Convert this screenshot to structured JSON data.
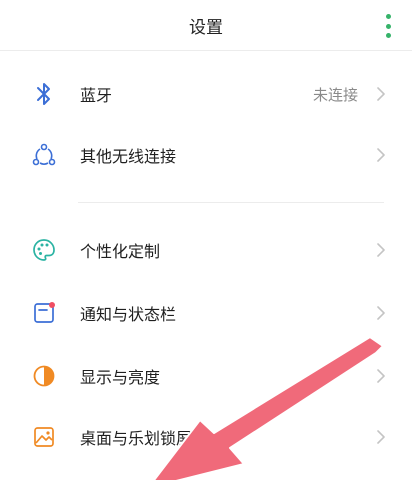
{
  "header": {
    "title": "设置",
    "more_icon": "more-vertical-icon"
  },
  "colors": {
    "accent": "#35b36a",
    "arrow": "#f06a7a"
  },
  "settings": {
    "items": [
      {
        "label": "蓝牙",
        "status": "未连接",
        "icon": "bluetooth-icon"
      },
      {
        "label": "其他无线连接",
        "status": "",
        "icon": "wireless-share-icon"
      },
      {
        "label": "个性化定制",
        "status": "",
        "icon": "palette-icon"
      },
      {
        "label": "通知与状态栏",
        "status": "",
        "icon": "notification-icon"
      },
      {
        "label": "显示与亮度",
        "status": "",
        "icon": "brightness-icon"
      },
      {
        "label": "桌面与乐划锁屏",
        "status": "",
        "icon": "wallpaper-icon"
      }
    ]
  }
}
